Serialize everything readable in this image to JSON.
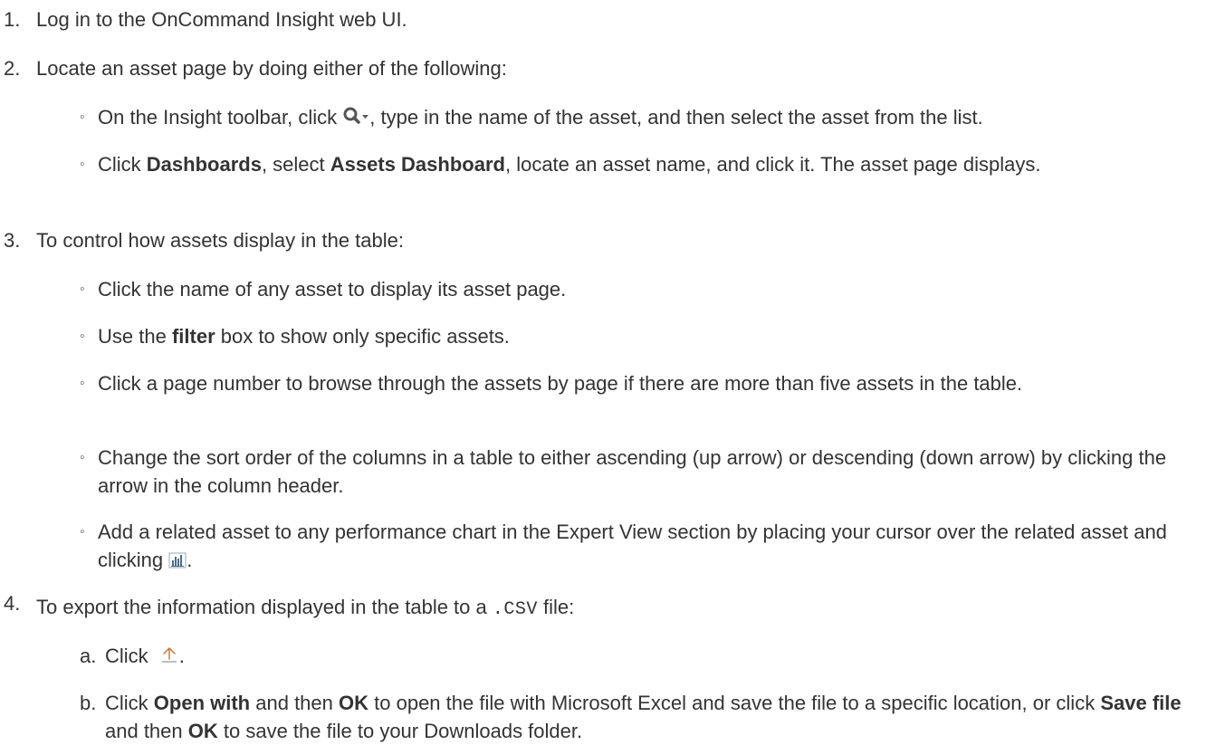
{
  "steps": [
    {
      "num": "1.",
      "text": "Log in to the OnCommand Insight web UI."
    },
    {
      "num": "2.",
      "text": "Locate an asset page by doing either of the following:"
    },
    {
      "num": "3.",
      "text": "To control how assets display in the table:"
    },
    {
      "num": "4.",
      "text_before": "To export the information displayed in the table to a",
      "code": ".CSV",
      "text_after": "file:"
    }
  ],
  "step2": {
    "a_prefix": "On the Insight toolbar, click",
    "a_suffix": ", type in the name of the asset, and then select the asset from the list.",
    "b_1": "Click",
    "b_dashboards": "Dashboards",
    "b_2": ", select",
    "b_assets": "Assets Dashboard",
    "b_3": ", locate an asset name, and click it. The asset page displays."
  },
  "step3": {
    "item1": "Click the name of any asset to display its asset page.",
    "item2_a": "Use the",
    "item2_b": "filter",
    "item2_c": "box to show only specific assets.",
    "item3": "Click a page number to browse through the assets by page if there are more than five assets in the table.",
    "item4": "Change the sort order of the columns in a table to either ascending (up arrow) or descending (down arrow) by clicking the arrow in the column header.",
    "item5_a": "Add a related asset to any performance chart in the Expert View section by placing your cursor over the related asset and clicking",
    "item5_b": "."
  },
  "step4": {
    "a_label": "a.",
    "a_text": "Click",
    "a_end": ".",
    "b_label": "b.",
    "b_1": "Click",
    "b_openwith": "Open with",
    "b_2": "and then",
    "b_ok1": "OK",
    "b_3": "to open the file with Microsoft Excel and save the file to a specific location, or click",
    "b_savefile": "Save file",
    "b_4": "and then",
    "b_ok2": "OK",
    "b_5": "to save the file to your Downloads folder."
  },
  "bullet_glyph": "◦",
  "icons": {
    "search": "search-dropdown-icon",
    "chart": "bar-chart-icon",
    "export": "export-upload-icon"
  },
  "colors": {
    "text": "#333333",
    "search_icon": "#555555",
    "export_icon": "#c47a3a",
    "chart_icon": "#4a6d8c"
  }
}
